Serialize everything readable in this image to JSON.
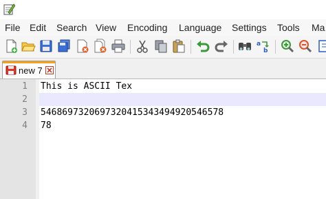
{
  "menu": {
    "items": [
      "File",
      "Edit",
      "Search",
      "View",
      "Encoding",
      "Language",
      "Settings",
      "Tools",
      "Ma"
    ]
  },
  "toolbar": {
    "buttons": [
      "new-file-icon",
      "open-file-icon",
      "save-icon",
      "save-all-icon",
      "close-icon",
      "close-all-icon",
      "print-icon",
      "cut-icon",
      "copy-icon",
      "paste-icon",
      "undo-icon",
      "redo-icon",
      "find-icon",
      "replace-icon",
      "zoom-in-icon",
      "zoom-out-icon",
      "sync-scroll-icon"
    ]
  },
  "tabs": [
    {
      "label": "new 7",
      "icon": "unsaved-disk-icon",
      "close_icon": "close-tab-icon"
    }
  ],
  "editor": {
    "line_numbers": [
      "1",
      "2",
      "3",
      "4"
    ],
    "lines": [
      "This is ASCII Tex",
      "",
      "5468697320697320415343494920546578",
      "78"
    ]
  },
  "colors": {
    "accent_tab": "#f4a21b",
    "current_line": "#e8e8ff",
    "gutter": "#e4e4e4"
  }
}
